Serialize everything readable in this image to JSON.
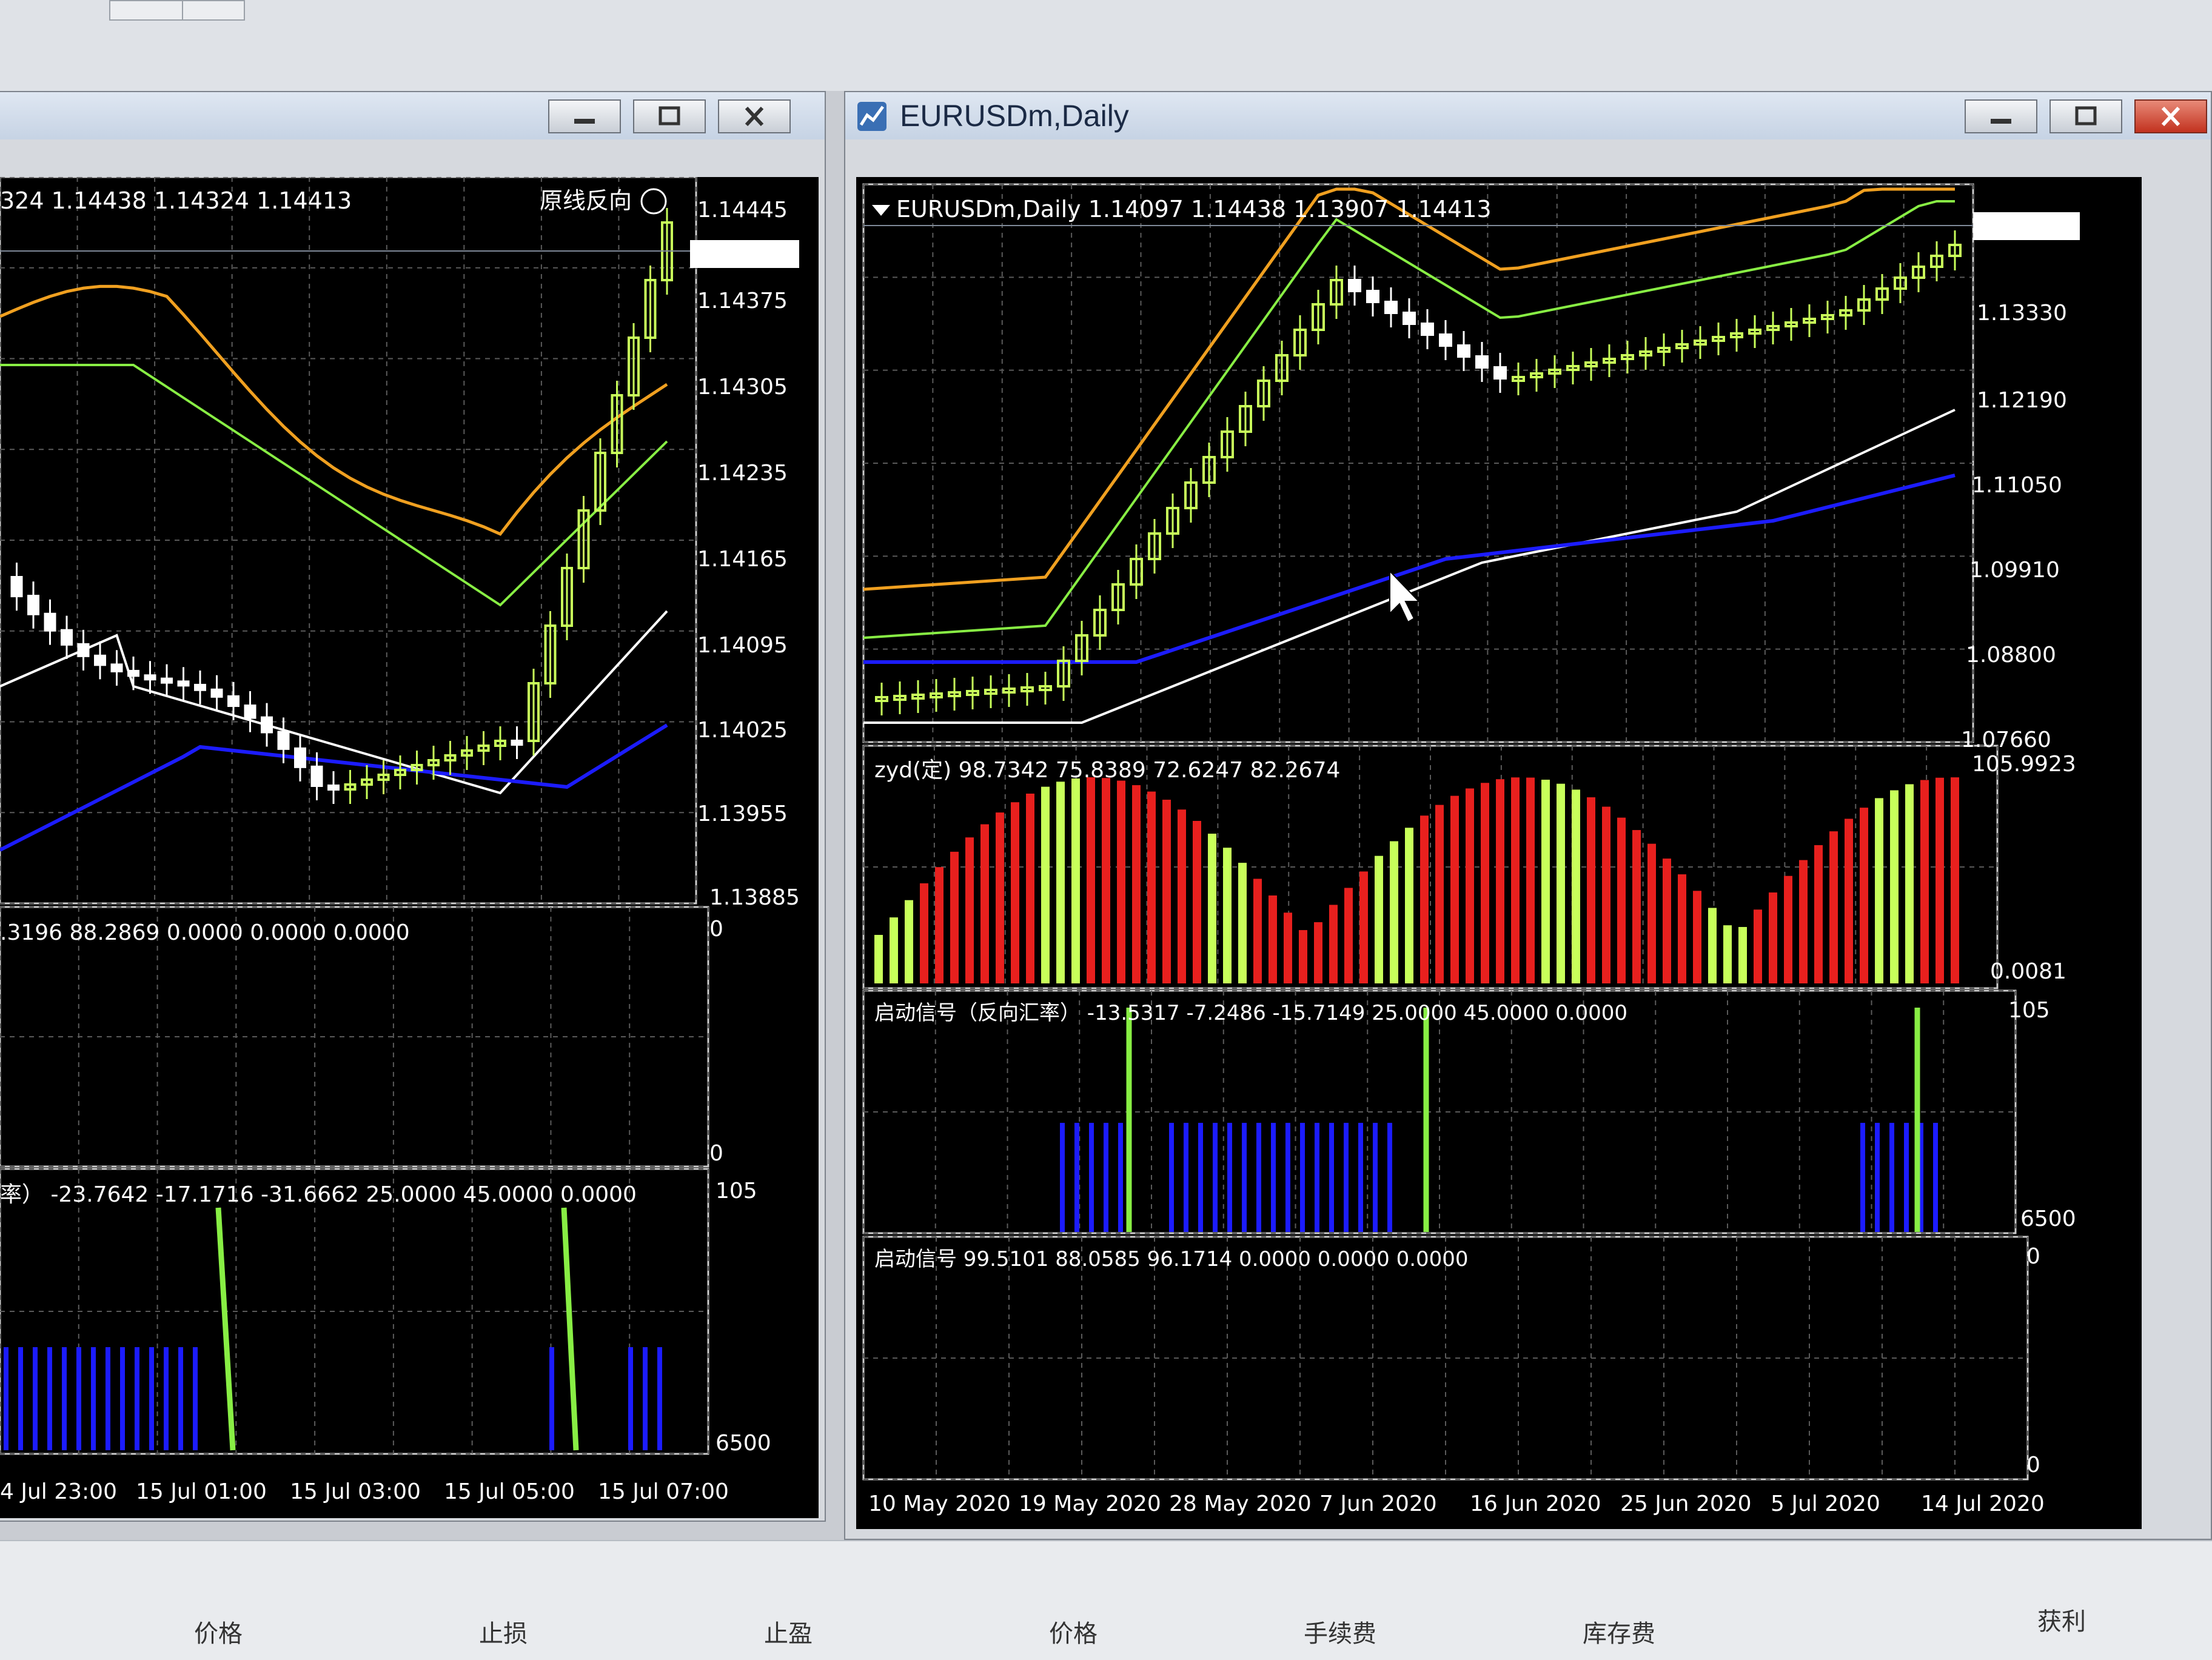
{
  "left_window": {
    "price_header": "324 1.14438 1.14324 1.14413",
    "overlay_label": "原线反向",
    "price_axis": [
      "1.14445",
      "1.14375",
      "1.14305",
      "1.14235",
      "1.14165",
      "1.14095",
      "1.14025",
      "1.13955",
      "1.13885"
    ],
    "current_price": "1.14413",
    "indicator1_header": ".3196 88.2869 0.0000 0.0000 0.0000",
    "indicator1_axis": [
      "0",
      "0"
    ],
    "indicator2_header": "率） -23.7642 -17.1716 -31.6662 25.0000 45.0000 0.0000",
    "indicator2_axis": [
      "105",
      "6500"
    ],
    "time_axis": [
      "4 Jul 23:00",
      "15 Jul 01:00",
      "15 Jul 03:00",
      "15 Jul 05:00",
      "15 Jul 07:00"
    ]
  },
  "right_window": {
    "title": "EURUSDm,Daily",
    "price_header": "EURUSDm,Daily  1.14097 1.14438 1.13907 1.14413",
    "price_axis": [
      "1.13330",
      "1.12190",
      "1.11050",
      "1.09910",
      "1.08800",
      "1.07660"
    ],
    "current_price": "1.14413",
    "zyd_header": "zyd(定) 98.7342 75.8389 72.6247 82.2674",
    "zyd_axis": [
      "105.9923",
      "0.0081"
    ],
    "signal1_header": "启动信号（反向汇率） -13.5317 -7.2486 -15.7149 25.0000 45.0000 0.0000",
    "signal1_axis": [
      "105",
      "6500"
    ],
    "signal2_header": "启动信号 99.5101 88.0585 96.1714 0.0000 0.0000 0.0000",
    "signal2_axis": [
      "0",
      "0"
    ],
    "time_axis": [
      "10 May 2020",
      "19 May 2020",
      "28 May 2020",
      "7 Jun 2020",
      "16 Jun 2020",
      "25 Jun 2020",
      "5 Jul 2020",
      "14 Jul 2020"
    ]
  },
  "columns": [
    "价格",
    "止损",
    "止盈",
    "价格",
    "手续费",
    "库存费",
    "获利"
  ],
  "colors": {
    "bull": "#c8ff5a",
    "bear": "#ffffff",
    "red_bar": "#e8201e",
    "blue_ma": "#1c1cff",
    "orange": "#f0a020",
    "green_ma": "#88ee44",
    "grid": "#5a5a5a"
  }
}
